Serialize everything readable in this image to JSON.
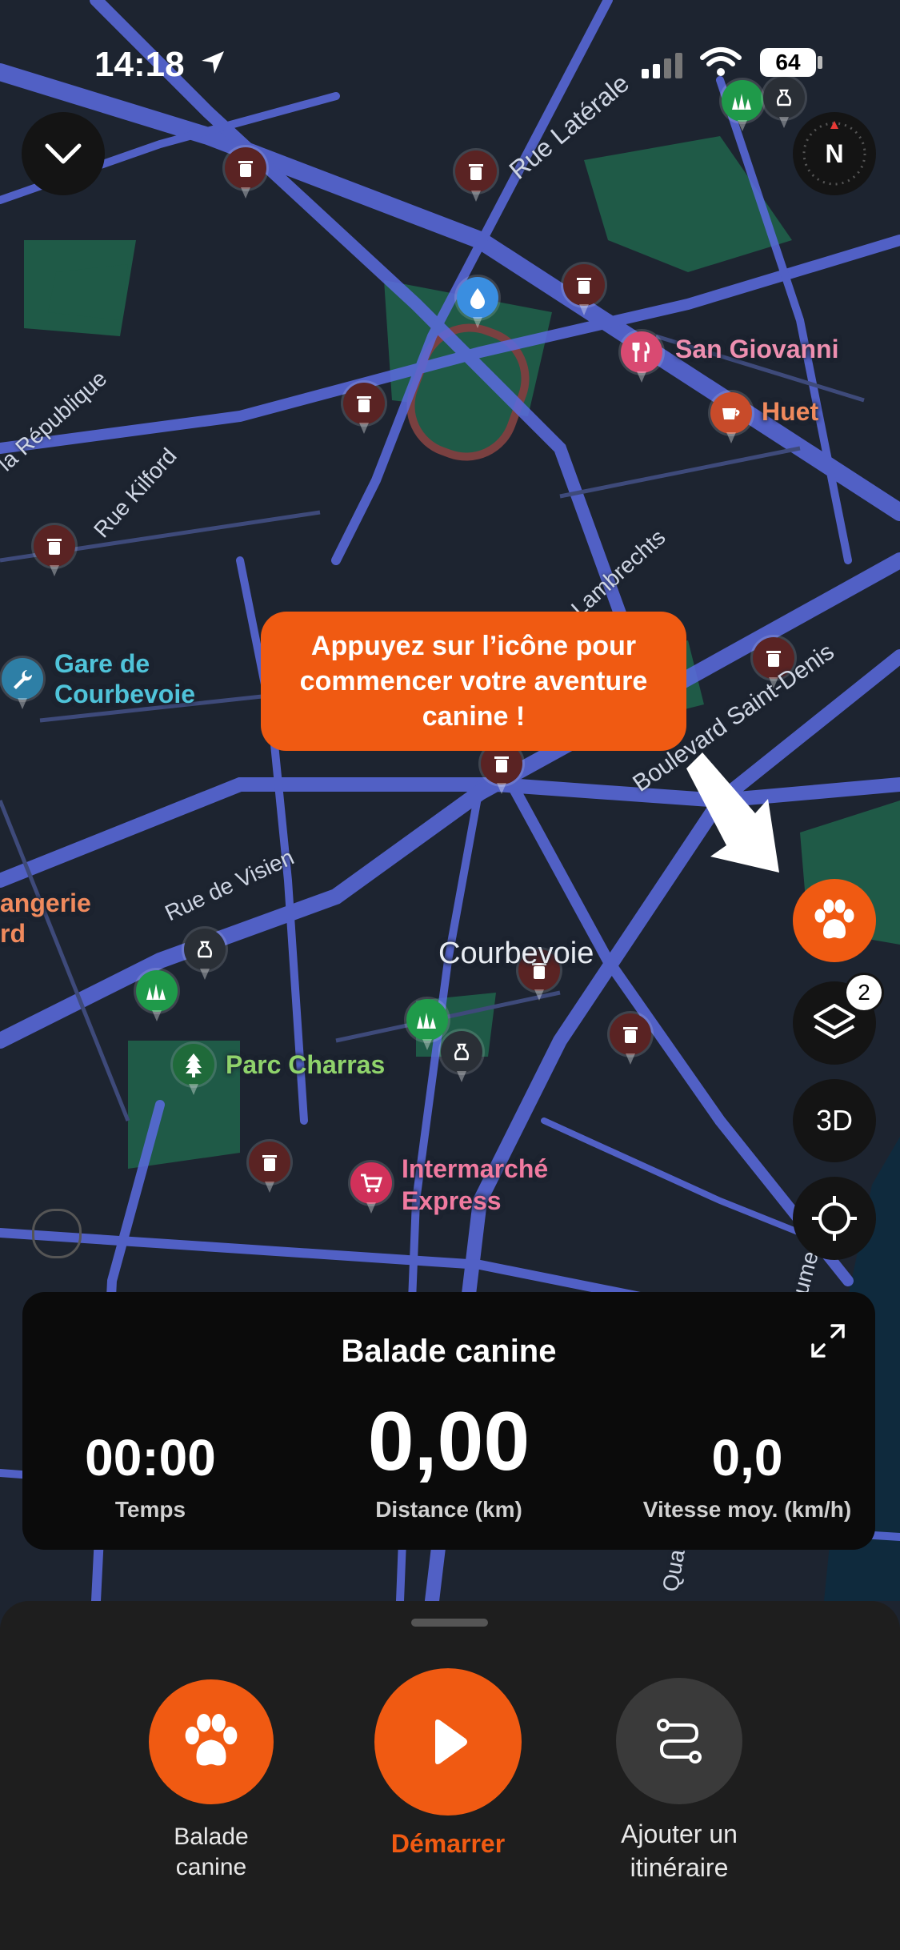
{
  "status_bar": {
    "time": "14:18",
    "battery": "64"
  },
  "map": {
    "compass_letter": "N",
    "layers_badge": "2",
    "view_3d_label": "3D",
    "places": {
      "san_giovanni": "San Giovanni",
      "huet": "Huet",
      "gare": "Gare de Courbevoie",
      "courbevoie": "Courbevoie",
      "parc_charras": "Parc Charras",
      "intermarche": "Intermarché Express",
      "angerie": "angerie",
      "rd": "rd"
    },
    "streets": {
      "rue_laterale": "Rue Latérale",
      "republique": "la République",
      "kilford": "Rue Kilford",
      "lambrechts": "Lambrechts",
      "saint_denis": "Boulevard Saint-Denis",
      "visien": "Rue de Visien",
      "quai_1": "ume",
      "quai_2": "Qua"
    }
  },
  "callout": {
    "text": "Appuyez sur l’icône pour commencer votre aventure canine !"
  },
  "walk_card": {
    "title": "Balade canine",
    "time_value": "00:00",
    "time_label": "Temps",
    "distance_value": "0,00",
    "distance_label": "Distance (km)",
    "speed_value": "0,0",
    "speed_label": "Vitesse moy. (km/h)"
  },
  "bottom_sheet": {
    "walk_label": "Balade canine",
    "start_label": "Démarrer",
    "route_label": "Ajouter un itinéraire"
  },
  "colors": {
    "accent": "#f05a12",
    "map_bg": "#1d2430",
    "road": "#5b6be0",
    "park": "#1f5a47",
    "poi_trash": "#5a2323",
    "poi_restaurant": "#d94a72",
    "poi_cafe": "#c84b2a",
    "poi_grass": "#1f9a4a"
  }
}
